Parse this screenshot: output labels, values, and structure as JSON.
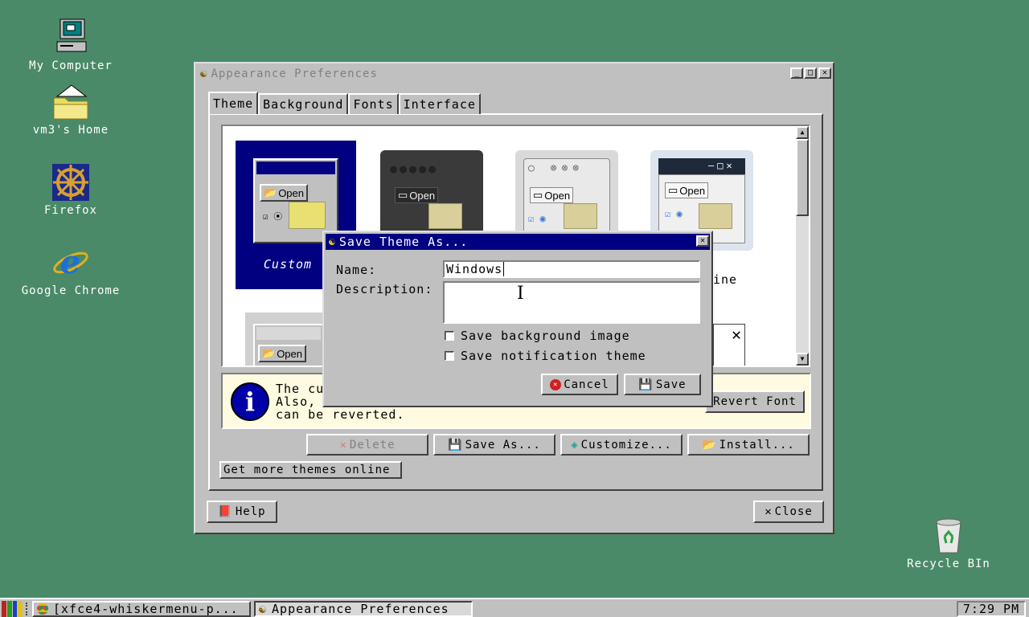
{
  "desktop": {
    "icons": [
      {
        "label": "My Computer"
      },
      {
        "label": "vm3's Home"
      },
      {
        "label": "Firefox"
      },
      {
        "label": "Google Chrome"
      },
      {
        "label": "Recycle BIn"
      }
    ]
  },
  "window": {
    "title": "Appearance Preferences",
    "tabs": [
      "Theme",
      "Background",
      "Fonts",
      "Interface"
    ],
    "themes": [
      {
        "label": "Custom",
        "open_label": "Open"
      },
      {
        "label": "",
        "open_label": "Open"
      },
      {
        "label": "",
        "open_label": "Open"
      },
      {
        "label": "ine",
        "open_label": "Open"
      },
      {
        "label": "",
        "open_label": "Open"
      }
    ],
    "info": {
      "text": "The cu\nAlso,\ncan be reverted.",
      "revert_font_label": "Revert Font"
    },
    "buttons": {
      "delete": "Delete",
      "save_as": "Save As...",
      "customize": "Customize...",
      "install": "Install...",
      "get_more": "Get more themes online",
      "help": "Help",
      "close": "Close"
    }
  },
  "dialog": {
    "title": "Save Theme As...",
    "name_label": "Name:",
    "name_value": "Windows",
    "description_label": "Description:",
    "description_value": "",
    "checkbox_background": "Save background image",
    "checkbox_notification": "Save notification theme",
    "cancel": "Cancel",
    "save": "Save"
  },
  "taskbar": {
    "tasks": [
      "[xfce4-whiskermenu-p...",
      "Appearance Preferences"
    ],
    "clock": "7:29 PM"
  },
  "colors": {
    "desktop": "#4a8a68",
    "titlebar_active": "#000080",
    "selected_theme": "#000080",
    "info_background": "#fffbe0"
  }
}
